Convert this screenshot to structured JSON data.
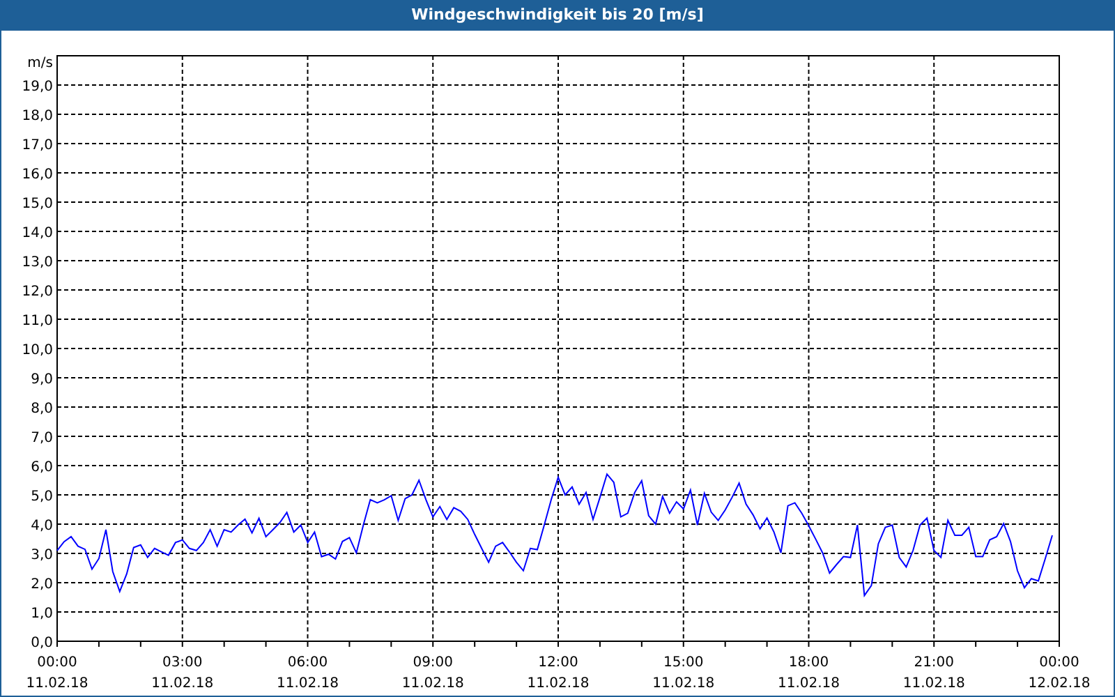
{
  "window": {
    "title": "Windgeschwindigkeit bis 20 [m/s]"
  },
  "chart": {
    "chart_data": {
      "type": "line",
      "ylabel": "m/s",
      "grid": true,
      "categories": [
        "00:00 11.02.18",
        null,
        null,
        null,
        null,
        null,
        null,
        null,
        null,
        null,
        null,
        null,
        null,
        null,
        null,
        null,
        null,
        null,
        "03:00 11.02.18",
        null,
        null,
        null,
        null,
        null,
        null,
        null,
        null,
        null,
        null,
        null,
        null,
        null,
        null,
        null,
        null,
        null,
        "06:00 11.02.18",
        null,
        null,
        null,
        null,
        null,
        null,
        null,
        null,
        null,
        null,
        null,
        null,
        null,
        null,
        null,
        null,
        null,
        "09:00 11.02.18",
        null,
        null,
        null,
        null,
        null,
        null,
        null,
        null,
        null,
        null,
        null,
        null,
        null,
        null,
        null,
        null,
        null,
        "12:00 11.02.18",
        null,
        null,
        null,
        null,
        null,
        null,
        null,
        null,
        null,
        null,
        null,
        null,
        null,
        null,
        null,
        null,
        null,
        "15:00 11.02.18",
        null,
        null,
        null,
        null,
        null,
        null,
        null,
        null,
        null,
        null,
        null,
        null,
        null,
        null,
        null,
        null,
        null,
        "18:00 11.02.18",
        null,
        null,
        null,
        null,
        null,
        null,
        null,
        null,
        null,
        null,
        null,
        null,
        null,
        null,
        null,
        null,
        null,
        "21:00 11.02.18",
        null,
        null,
        null,
        null,
        null,
        null,
        null,
        null,
        null,
        null,
        null,
        null,
        null,
        null,
        null,
        null,
        null,
        "00:00 12.02.18"
      ],
      "series": [
        {
          "color": "#0000ff",
          "values": [
            3.1,
            3.4,
            3.57,
            3.25,
            3.14,
            2.46,
            2.83,
            3.81,
            2.38,
            1.7,
            2.3,
            3.2,
            3.29,
            2.86,
            3.17,
            3.05,
            2.94,
            3.37,
            3.46,
            3.17,
            3.1,
            3.37,
            3.81,
            3.25,
            3.81,
            3.73,
            3.97,
            4.17,
            3.7,
            4.2,
            3.57,
            3.81,
            4.05,
            4.4,
            3.73,
            3.97,
            3.37,
            3.73,
            2.89,
            2.97,
            2.81,
            3.41,
            3.54,
            3.02,
            3.97,
            4.84,
            4.73,
            4.83,
            4.97,
            4.13,
            4.87,
            5.0,
            5.5,
            4.84,
            4.25,
            4.6,
            4.16,
            4.56,
            4.44,
            4.16,
            3.65,
            3.17,
            2.7,
            3.25,
            3.37,
            3.05,
            2.7,
            2.41,
            3.17,
            3.13,
            3.97,
            4.84,
            5.6,
            5.0,
            5.27,
            4.68,
            5.08,
            4.16,
            4.92,
            5.71,
            5.43,
            4.25,
            4.37,
            5.08,
            5.48,
            4.29,
            4.0,
            4.95,
            4.37,
            4.76,
            4.52,
            5.16,
            3.97,
            5.05,
            4.41,
            4.13,
            4.48,
            4.92,
            5.4,
            4.68,
            4.32,
            3.84,
            4.21,
            3.73,
            3.02,
            4.63,
            4.73,
            4.37,
            3.94,
            3.49,
            3.02,
            2.33,
            2.62,
            2.89,
            2.86,
            3.97,
            1.56,
            1.9,
            3.33,
            3.89,
            3.97,
            2.86,
            2.54,
            3.1,
            3.97,
            4.21,
            3.1,
            2.86,
            4.13,
            3.62,
            3.62,
            3.89,
            2.89,
            2.89,
            3.46,
            3.57,
            4.02,
            3.41,
            2.41,
            1.83,
            2.14,
            2.06,
            2.83,
            3.62,
            null
          ]
        }
      ],
      "ylim": [
        0,
        20
      ],
      "yticks": [
        {
          "value": 0,
          "label": "0,0"
        },
        {
          "value": 1,
          "label": "1,0"
        },
        {
          "value": 2,
          "label": "2,0"
        },
        {
          "value": 3,
          "label": "3,0"
        },
        {
          "value": 4,
          "label": "4,0"
        },
        {
          "value": 5,
          "label": "5,0"
        },
        {
          "value": 6,
          "label": "6,0"
        },
        {
          "value": 7,
          "label": "7,0"
        },
        {
          "value": 8,
          "label": "8,0"
        },
        {
          "value": 9,
          "label": "9,0"
        },
        {
          "value": 10,
          "label": "10,0"
        },
        {
          "value": 11,
          "label": "11,0"
        },
        {
          "value": 12,
          "label": "12,0"
        },
        {
          "value": 13,
          "label": "13,0"
        },
        {
          "value": 14,
          "label": "14,0"
        },
        {
          "value": 15,
          "label": "15,0"
        },
        {
          "value": 16,
          "label": "16,0"
        },
        {
          "value": 17,
          "label": "17,0"
        },
        {
          "value": 18,
          "label": "18,0"
        },
        {
          "value": 19,
          "label": "19,0"
        }
      ]
    }
  }
}
